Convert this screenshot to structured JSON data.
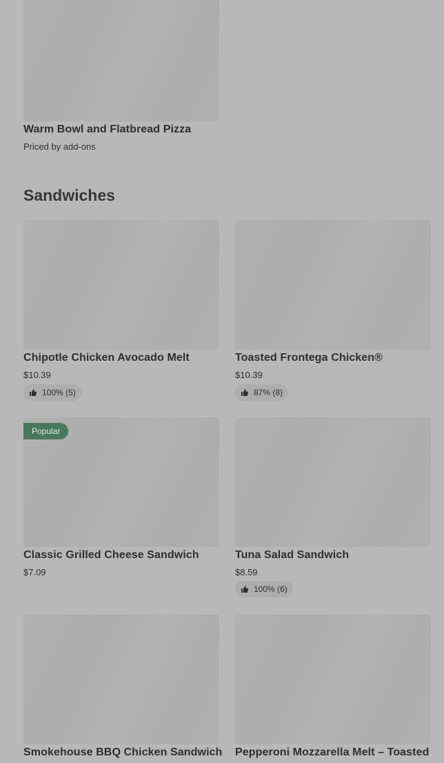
{
  "top_item": {
    "title": "Warm Bowl and Flatbread Pizza",
    "subtitle": "Priced by add-ons"
  },
  "section": {
    "title": "Sandwiches"
  },
  "items": [
    {
      "title": "Chipotle Chicken Avocado Melt",
      "price": "$10.39",
      "rating": "100% (5)"
    },
    {
      "title": "Toasted Frontega Chicken®",
      "price": "$10.39",
      "rating": "87% (8)"
    },
    {
      "title": "Classic Grilled Cheese Sandwich",
      "price": "$7.09",
      "badge": "Popular"
    },
    {
      "title": "Tuna Salad Sandwich",
      "price": "$8.59",
      "rating": "100% (6)"
    },
    {
      "title": "Smokehouse BBQ Chicken Sandwich"
    },
    {
      "title": "Pepperoni Mozzarella Melt – Toasted"
    }
  ],
  "icons": {
    "rating": "thumbs-up-icon"
  },
  "colors": {
    "background": "#b8b8b8",
    "image_placeholder": "#b0b0b0",
    "popular_badge": "#477a5c",
    "text": "#2e2e2e"
  }
}
